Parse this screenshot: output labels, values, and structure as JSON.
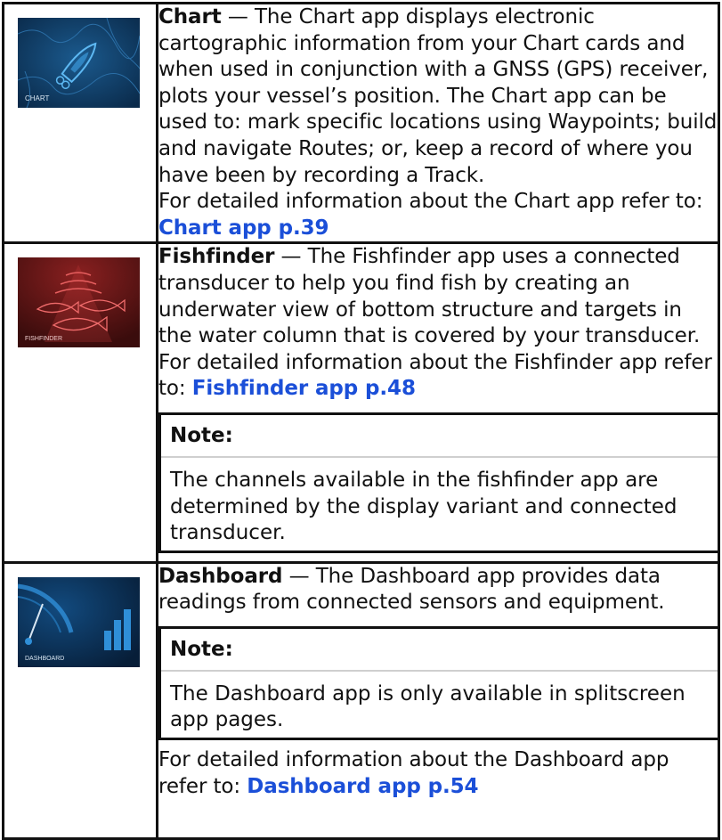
{
  "apps": [
    {
      "thumb_label": "CHART",
      "name": "Chart",
      "text": " — The Chart app displays electronic cartographic information from your Chart cards and when used in conjunction with a GNSS (GPS) receiver, plots your vessel’s position. The Chart app can be used to: mark specific locations using Waypoints; build and navigate Routes; or, keep a record of where you have been by recording a Track.",
      "ref_text": "For detailed information about the Chart app refer to:",
      "ref_link": "Chart app p.39",
      "colors": {
        "bg": "#0f3a63",
        "accent": "#3fa3e8"
      }
    },
    {
      "thumb_label": "FISHFINDER",
      "name": "Fishfinder",
      "text": " — The Fishfinder app uses a connected transducer to help you find fish by creating an underwater view of bottom structure and targets in the water column that is covered by your transducer. For detailed information about the Fishfinder app refer to:",
      "ref_link": "Fishfinder app p.48",
      "note_title": "Note:",
      "note_text": "The channels available in the fishfinder app are determined by the display variant and connected transducer.",
      "colors": {
        "bg": "#5a1414",
        "accent": "#e24a4a"
      }
    },
    {
      "thumb_label": "DASHBOARD",
      "name": "Dashboard",
      "text": " — The Dashboard app provides data readings from connected sensors and equipment.",
      "note_title": "Note:",
      "note_text": "The Dashboard app is only available in splitscreen app pages.",
      "ref_text": "For detailed information about the Dashboard app refer to:",
      "ref_link": "Dashboard app p.54",
      "colors": {
        "bg": "#0c2e52",
        "accent": "#2f8fd8"
      }
    }
  ],
  "link_color": "#1b4fd8"
}
